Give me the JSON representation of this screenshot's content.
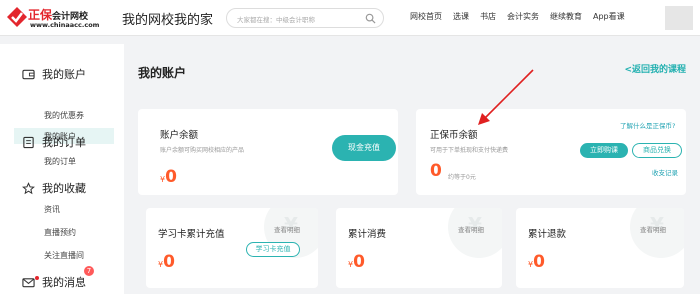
{
  "header": {
    "logo_main": "正保",
    "logo_sub": "会计网校",
    "logo_url": "www.chinaacc.com",
    "site_title": "我的网校我的家",
    "search_placeholder": "大家都在搜：中级会计职称",
    "nav": [
      "网校首页",
      "选课",
      "书店",
      "会计实务",
      "继续教育",
      "App看课"
    ]
  },
  "sidebar": {
    "sections": [
      {
        "title": "我的账户",
        "icon": "wallet-icon",
        "items": [
          "我的账户",
          "我的优惠券"
        ]
      },
      {
        "title": "我的订单",
        "icon": "order-icon",
        "items": [
          "我的订单"
        ]
      },
      {
        "title": "我的收藏",
        "icon": "star-icon",
        "items": [
          "资讯",
          "直播预约",
          "关注直播间"
        ]
      },
      {
        "title": "我的消息",
        "icon": "mail-icon",
        "items": []
      }
    ],
    "message_badge": "7"
  },
  "main": {
    "title": "我的账户",
    "back_link": "<返回我的课程",
    "account_balance": {
      "title": "账户余额",
      "desc": "账户余额可购买网校相应的产品",
      "currency": "¥",
      "amount": "0",
      "button": "现金充值"
    },
    "coin_balance": {
      "title": "正保币余额",
      "help_link": "了解什么是正保币?",
      "desc": "可用于下单抵现和支付快递费",
      "amount": "0",
      "equals": "约等于0元",
      "buy_button": "立即购课",
      "exchange_button": "商品兑换",
      "history_link": "收支记录"
    },
    "cards": [
      {
        "title": "学习卡累计充值",
        "detail_link": "查看明细",
        "currency": "¥",
        "amount": "0",
        "button": "学习卡充值"
      },
      {
        "title": "累计消费",
        "detail_link": "查看明细",
        "currency": "¥",
        "amount": "0"
      },
      {
        "title": "累计退款",
        "detail_link": "查看明细",
        "currency": "¥",
        "amount": "0"
      }
    ]
  },
  "colors": {
    "brand": "#e3262d",
    "accent": "#2bb3b1",
    "amount": "#ff5a2a",
    "annotation_arrow": "#e02020"
  }
}
